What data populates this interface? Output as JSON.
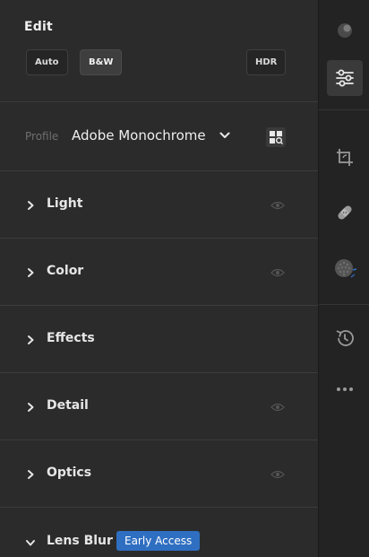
{
  "panel": {
    "title": "Edit",
    "modes": {
      "auto": "Auto",
      "bw": "B&W",
      "hdr": "HDR"
    },
    "profile": {
      "label": "Profile",
      "value": "Adobe Monochrome"
    },
    "sections": [
      {
        "label": "Light",
        "eye": true
      },
      {
        "label": "Color",
        "eye": true
      },
      {
        "label": "Effects",
        "eye": false
      },
      {
        "label": "Detail",
        "eye": true
      },
      {
        "label": "Optics",
        "eye": true
      }
    ],
    "lens_blur": {
      "label": "Lens Blur",
      "badge": "Early Access"
    }
  },
  "rail": {
    "tools": [
      "ai-icon",
      "edit-sliders-icon",
      "crop-icon",
      "heal-icon",
      "masking-icon",
      "history-icon",
      "more-icon"
    ],
    "active_tool": "edit-sliders-icon"
  },
  "colors": {
    "badge": "#2f6fc1",
    "panel_bg": "#2b2b2b",
    "rail_bg": "#232323"
  }
}
